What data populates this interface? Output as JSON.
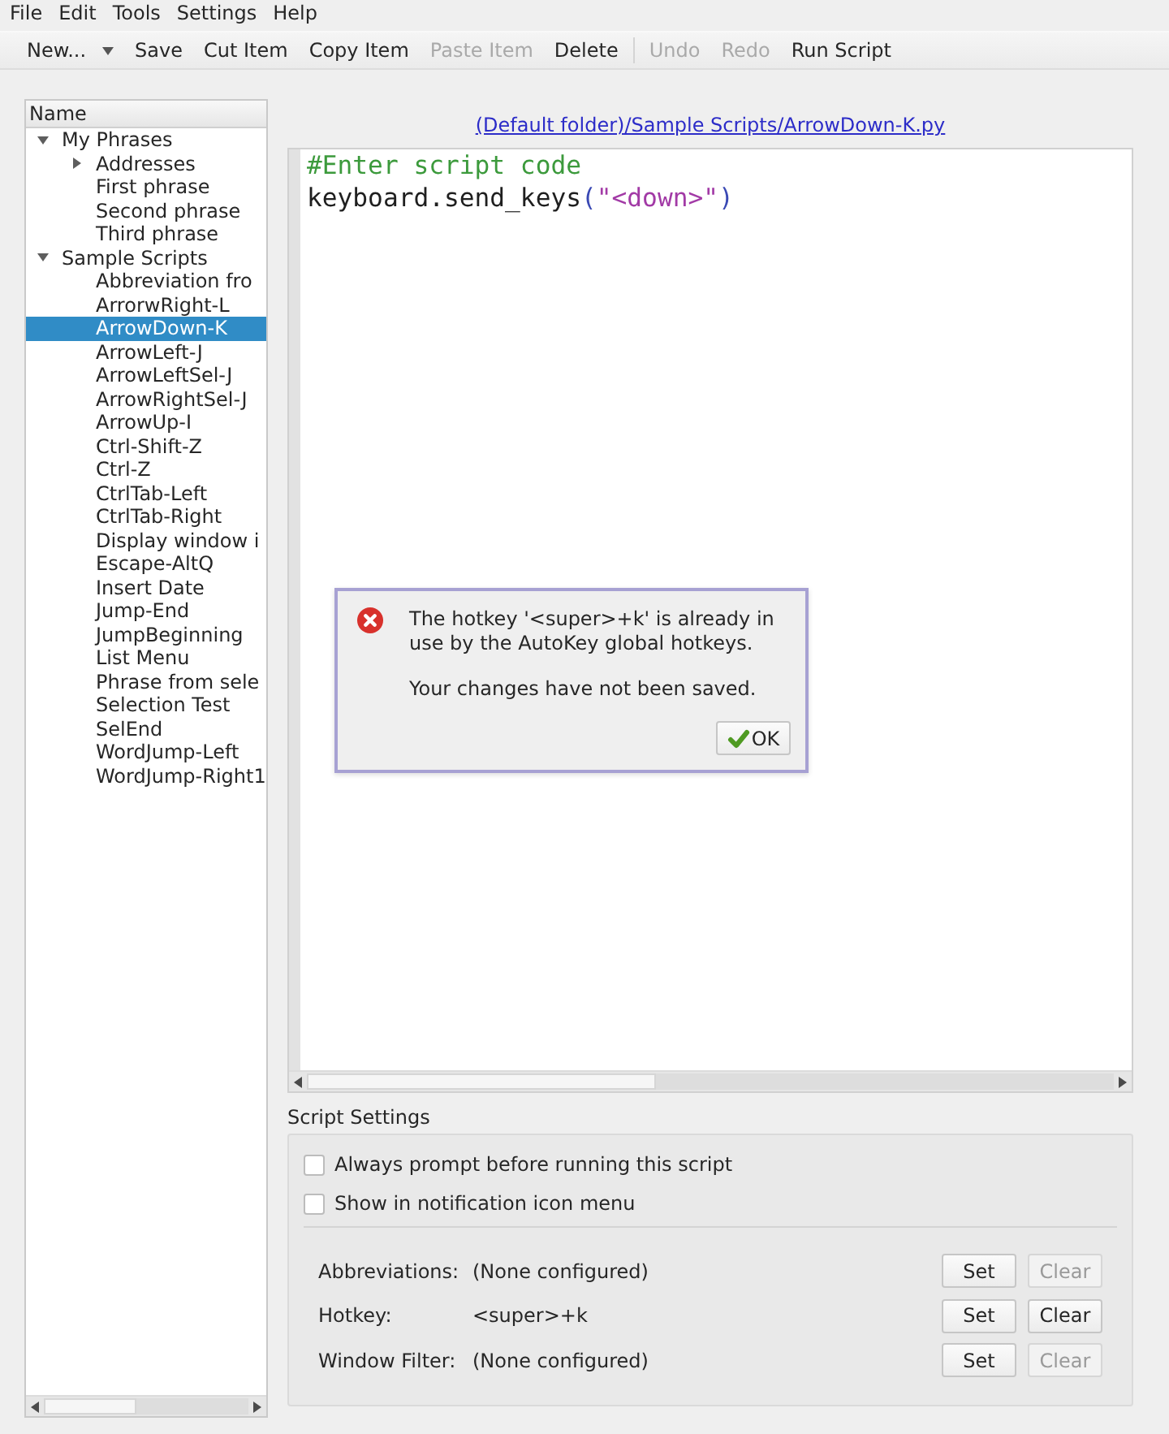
{
  "menu_bar": [
    {
      "label": "File"
    },
    {
      "label": "Edit"
    },
    {
      "label": "Tools"
    },
    {
      "label": "Settings"
    },
    {
      "label": "Help"
    }
  ],
  "toolbar": [
    {
      "kind": "menu_button",
      "label": "New...",
      "disabled": false
    },
    {
      "kind": "button",
      "label": "Save",
      "disabled": false
    },
    {
      "kind": "button",
      "label": "Cut Item",
      "disabled": false
    },
    {
      "kind": "button",
      "label": "Copy Item",
      "disabled": false
    },
    {
      "kind": "button",
      "label": "Paste Item",
      "disabled": true
    },
    {
      "kind": "button",
      "label": "Delete",
      "disabled": false
    },
    {
      "kind": "separator"
    },
    {
      "kind": "button",
      "label": "Undo",
      "disabled": true
    },
    {
      "kind": "button",
      "label": "Redo",
      "disabled": true
    },
    {
      "kind": "button",
      "label": "Run Script",
      "disabled": false
    }
  ],
  "tree": {
    "header": "Name",
    "items": [
      {
        "kind": "folder",
        "label": "My Phrases",
        "expanded": true,
        "selected": false,
        "children": [
          {
            "kind": "folder",
            "label": "Addresses",
            "expanded": false,
            "selected": false
          },
          {
            "kind": "item",
            "label": "First phrase",
            "selected": false
          },
          {
            "kind": "item",
            "label": "Second phrase",
            "selected": false
          },
          {
            "kind": "item",
            "label": "Third phrase",
            "selected": false
          }
        ]
      },
      {
        "kind": "folder",
        "label": "Sample Scripts",
        "expanded": true,
        "selected": false,
        "children": [
          {
            "kind": "item",
            "label": "Abbreviation fro",
            "selected": false
          },
          {
            "kind": "item",
            "label": "ArrorwRight-L",
            "selected": false
          },
          {
            "kind": "item",
            "label": "ArrowDown-K",
            "selected": true
          },
          {
            "kind": "item",
            "label": "ArrowLeft-J",
            "selected": false
          },
          {
            "kind": "item",
            "label": "ArrowLeftSel-J",
            "selected": false
          },
          {
            "kind": "item",
            "label": "ArrowRightSel-J",
            "selected": false
          },
          {
            "kind": "item",
            "label": "ArrowUp-I",
            "selected": false
          },
          {
            "kind": "item",
            "label": "Ctrl-Shift-Z",
            "selected": false
          },
          {
            "kind": "item",
            "label": "Ctrl-Z",
            "selected": false
          },
          {
            "kind": "item",
            "label": "CtrlTab-Left",
            "selected": false
          },
          {
            "kind": "item",
            "label": "CtrlTab-Right",
            "selected": false
          },
          {
            "kind": "item",
            "label": "Display window i",
            "selected": false
          },
          {
            "kind": "item",
            "label": "Escape-AltQ",
            "selected": false
          },
          {
            "kind": "item",
            "label": "Insert Date",
            "selected": false
          },
          {
            "kind": "item",
            "label": "Jump-End",
            "selected": false
          },
          {
            "kind": "item",
            "label": "JumpBeginning",
            "selected": false
          },
          {
            "kind": "item",
            "label": "List Menu",
            "selected": false
          },
          {
            "kind": "item",
            "label": "Phrase from sele",
            "selected": false
          },
          {
            "kind": "item",
            "label": "Selection Test",
            "selected": false
          },
          {
            "kind": "item",
            "label": "SelEnd",
            "selected": false
          },
          {
            "kind": "item",
            "label": "WordJump-Left",
            "selected": false
          },
          {
            "kind": "item",
            "label": "WordJump-Right1",
            "selected": false
          }
        ]
      }
    ]
  },
  "editor": {
    "path_link": "(Default folder)/Sample Scripts/ArrowDown-K.py",
    "lines": [
      [
        {
          "kind": "comment",
          "text": "#Enter script code"
        }
      ],
      [
        {
          "kind": "plain",
          "text": "keyboard.send_keys"
        },
        {
          "kind": "paren",
          "text": "("
        },
        {
          "kind": "string",
          "text": "\"<down>\""
        },
        {
          "kind": "paren",
          "text": ")"
        }
      ]
    ]
  },
  "script_settings": {
    "title": "Script Settings",
    "options": [
      {
        "label": "Always prompt before running this script",
        "checked": false
      },
      {
        "label": "Show in notification icon menu",
        "checked": false
      }
    ],
    "rows": [
      {
        "label": "Abbreviations:",
        "value": "(None configured)",
        "buttons": [
          {
            "label": "Set",
            "disabled": false
          },
          {
            "label": "Clear",
            "disabled": true
          }
        ]
      },
      {
        "label": "Hotkey:",
        "value": "<super>+k",
        "buttons": [
          {
            "label": "Set",
            "disabled": false
          },
          {
            "label": "Clear",
            "disabled": false
          }
        ]
      },
      {
        "label": "Window Filter:",
        "value": "(None configured)",
        "buttons": [
          {
            "label": "Set",
            "disabled": false
          },
          {
            "label": "Clear",
            "disabled": true
          }
        ]
      }
    ]
  },
  "dialog": {
    "kind": "error",
    "messages": [
      "The hotkey '<super>+k' is already in use by the AutoKey global hotkeys.",
      "Your changes have not been saved."
    ],
    "button": "OK"
  }
}
